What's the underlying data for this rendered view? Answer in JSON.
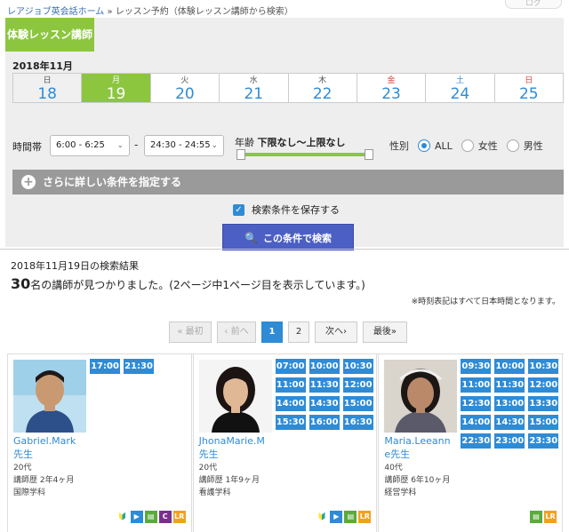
{
  "breadcrumb": {
    "home": "レアジョブ英会話ホーム",
    "sep": "»",
    "current": "レッスン予約（体験レッスン講師から検索）"
  },
  "top_button": "ログ",
  "panel": {
    "tab": "体験レッスン講師",
    "month": "2018年11月",
    "days": [
      {
        "dow": "日",
        "num": "18"
      },
      {
        "dow": "月",
        "num": "19"
      },
      {
        "dow": "火",
        "num": "20"
      },
      {
        "dow": "水",
        "num": "21"
      },
      {
        "dow": "木",
        "num": "22"
      },
      {
        "dow": "金",
        "num": "23"
      },
      {
        "dow": "土",
        "num": "24"
      },
      {
        "dow": "日",
        "num": "25"
      }
    ],
    "time_label": "時間帯",
    "time_from": "6:00 - 6:25",
    "time_sep": "-",
    "time_to": "24:30 - 24:55",
    "age_label": "年齢",
    "age_value": "下限なし〜上限なし",
    "gender_label": "性別",
    "gender_options": [
      "ALL",
      "女性",
      "男性"
    ],
    "more_conditions": "さらに詳しい条件を指定する",
    "save_conditions": "検索条件を保存する",
    "search_button": "この条件で検索"
  },
  "results": {
    "title": "2018年11月19日の検索結果",
    "count": "30",
    "count_suffix": "名の講師が見つかりました。(2ページ中1ページ目を表示しています。)",
    "tz_note": "※時刻表記はすべて日本時間となります。"
  },
  "pager": {
    "first": "« 最初",
    "prev": "‹ 前へ",
    "pages": [
      "1",
      "2"
    ],
    "next": "次へ›",
    "last": "最後»"
  },
  "teachers": [
    {
      "name": "Gabriel.Mark先生",
      "age": "20代",
      "career": "講師歴 2年4ヶ月",
      "major": "国際学科",
      "slots": [
        "17:00",
        "21:30"
      ],
      "badges": [
        "beginner",
        "video",
        "material",
        "C",
        "LR"
      ]
    },
    {
      "name": "JhonaMarie.M先生",
      "age": "20代",
      "career": "講師歴 1年9ヶ月",
      "major": "看護学科",
      "slots": [
        "07:00",
        "10:00",
        "10:30",
        "11:00",
        "11:30",
        "12:00",
        "14:00",
        "14:30",
        "15:00",
        "15:30",
        "16:00",
        "16:30"
      ],
      "badges": [
        "beginner",
        "video",
        "material",
        "LR"
      ]
    },
    {
      "name": "Maria.Leeanne先生",
      "age": "40代",
      "career": "講師歴 6年10ヶ月",
      "major": "経営学科",
      "slots": [
        "09:30",
        "10:00",
        "10:30",
        "11:00",
        "11:30",
        "12:00",
        "12:30",
        "13:00",
        "13:30",
        "14:00",
        "14:30",
        "15:00",
        "22:30",
        "23:00",
        "23:30"
      ],
      "badges": [
        "material",
        "LR"
      ]
    }
  ],
  "colors": {
    "accent": "#8cc63f",
    "blue": "#2e8bd6",
    "search": "#4b5fc4"
  }
}
